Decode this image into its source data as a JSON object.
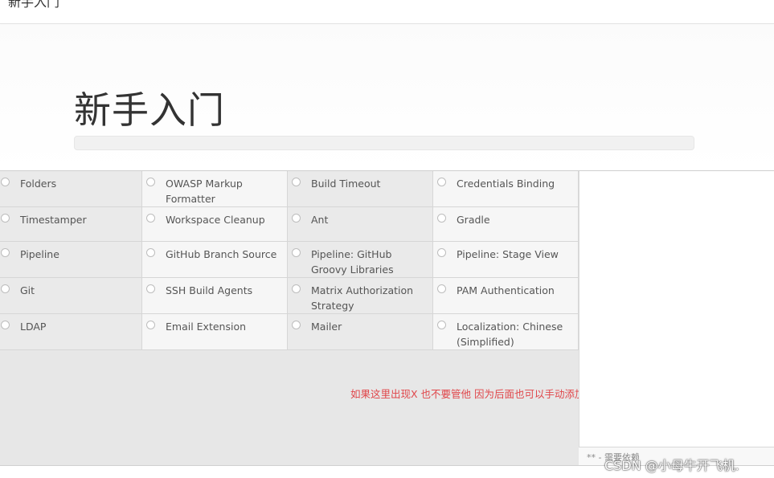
{
  "topbar": {
    "title": "新手入门"
  },
  "hero": {
    "title": "新手入门",
    "progress": 0
  },
  "plugins": [
    {
      "name": "Folders"
    },
    {
      "name": "OWASP Markup Formatter"
    },
    {
      "name": "Build Timeout"
    },
    {
      "name": "Credentials Binding"
    },
    {
      "name": "Timestamper"
    },
    {
      "name": "Workspace Cleanup"
    },
    {
      "name": "Ant"
    },
    {
      "name": "Gradle"
    },
    {
      "name": "Pipeline"
    },
    {
      "name": "GitHub Branch Source"
    },
    {
      "name": "Pipeline: GitHub Groovy Libraries"
    },
    {
      "name": "Pipeline: Stage View"
    },
    {
      "name": "Git"
    },
    {
      "name": "SSH Build Agents"
    },
    {
      "name": "Matrix Authorization Strategy"
    },
    {
      "name": "PAM Authentication"
    },
    {
      "name": "LDAP"
    },
    {
      "name": "Email Extension"
    },
    {
      "name": "Mailer"
    },
    {
      "name": "Localization: Chinese (Simplified)"
    }
  ],
  "note": "如果这里出现X 也不要管他 因为后面也可以手动添加集成的软件",
  "dependency_note": "** - 需要依赖",
  "watermark": "CSDN @小母牛开飞机."
}
